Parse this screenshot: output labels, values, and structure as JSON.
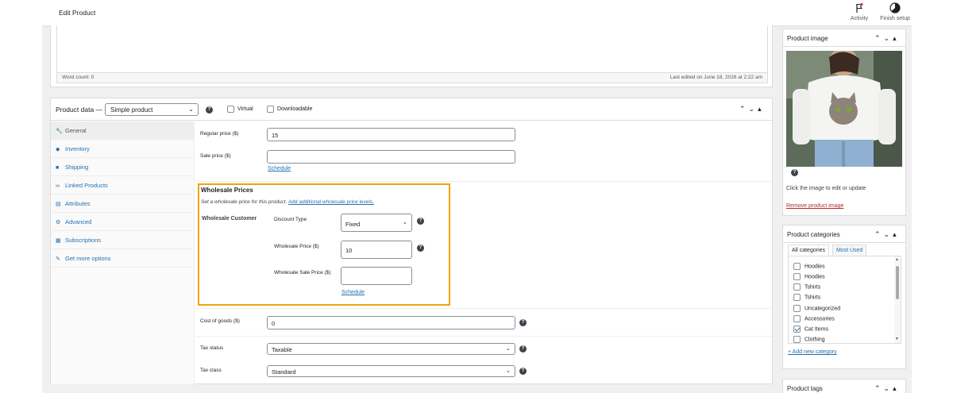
{
  "header": {
    "page_title": "Edit Product",
    "activity_label": "Activity",
    "finish_setup_label": "Finish setup"
  },
  "editor": {
    "word_count": "Word count: 0",
    "last_edited": "Last edited on June 18, 2026 at 2:22 am"
  },
  "product_data": {
    "title": "Product data —",
    "type_select": "Simple product",
    "virtual_label": "Virtual",
    "downloadable_label": "Downloadable",
    "tabs": [
      {
        "label": "General",
        "icon": "wrench-icon",
        "active": true
      },
      {
        "label": "Inventory",
        "icon": "tag-icon"
      },
      {
        "label": "Shipping",
        "icon": "truck-icon"
      },
      {
        "label": "Linked Products",
        "icon": "link-icon"
      },
      {
        "label": "Attributes",
        "icon": "list-icon"
      },
      {
        "label": "Advanced",
        "icon": "gear-icon"
      },
      {
        "label": "Subscriptions",
        "icon": "calendar-icon"
      },
      {
        "label": "Get more options",
        "icon": "plugin-icon"
      }
    ],
    "general": {
      "regular_price_label": "Regular price ($)",
      "regular_price_value": "15",
      "sale_price_label": "Sale price ($)",
      "sale_price_value": "",
      "schedule_link": "Schedule",
      "cost_of_goods_label": "Cost of goods ($)",
      "cost_of_goods_value": "0",
      "tax_status_label": "Tax status",
      "tax_status_value": "Taxable",
      "tax_class_label": "Tax class",
      "tax_class_value": "Standard"
    },
    "wholesale": {
      "title": "Wholesale Prices",
      "description": "Set a wholesale price for this product.",
      "description_link": "Add additional wholesale price levels.",
      "role": "Wholesale Customer",
      "discount_type_label": "Discount Type",
      "discount_type_value": "Fixed",
      "wholesale_price_label": "Wholesale Price ($)",
      "wholesale_price_value": "10",
      "wholesale_sale_price_label": "Wholesale Sale Price ($)",
      "wholesale_sale_price_value": "",
      "schedule_link": "Schedule",
      "highlight_color": "#f0a30a"
    }
  },
  "sidebar": {
    "product_image": {
      "title": "Product image",
      "hint": "Click the image to edit or update",
      "remove_link": "Remove product image"
    },
    "product_categories": {
      "title": "Product categories",
      "tab_all": "All categories",
      "tab_most_used": "Most Used",
      "items": [
        {
          "label": "Hoodies",
          "checked": false
        },
        {
          "label": "Hoodies",
          "checked": false
        },
        {
          "label": "Tshirts",
          "checked": false
        },
        {
          "label": "Tshirts",
          "checked": false
        },
        {
          "label": "Uncategorized",
          "checked": false
        },
        {
          "label": "Accessories",
          "checked": false
        },
        {
          "label": "Cat Items",
          "checked": true
        },
        {
          "label": "Clothing",
          "checked": false
        }
      ],
      "add_link": "+ Add new category"
    },
    "product_tags": {
      "title": "Product tags"
    }
  },
  "colors": {
    "accent": "#2271b1",
    "link_destructive": "#b32d2e"
  }
}
